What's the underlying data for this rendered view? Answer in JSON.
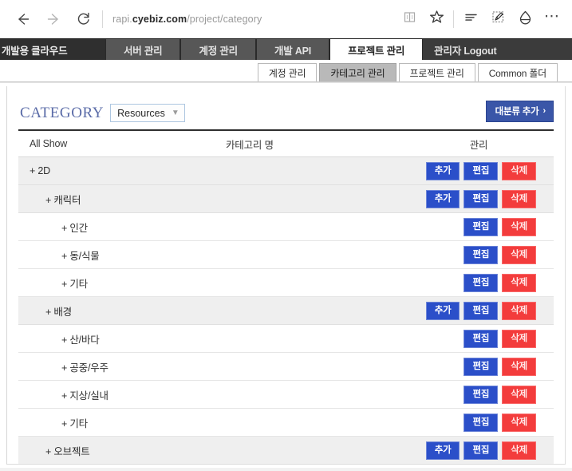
{
  "browser": {
    "back_icon": "arrow-left-icon",
    "forward_icon": "arrow-right-icon",
    "refresh_icon": "refresh-icon",
    "url_prefix": "rapi.",
    "url_host": "cyebiz.com",
    "url_path": "/project/category",
    "reading_view_icon": "book-icon",
    "favorites_icon": "star-icon",
    "hub_icon": "hub-lines-icon",
    "web_note_icon": "pen-note-icon",
    "share_icon": "share-icon",
    "more_label": "⋯"
  },
  "topnav": {
    "brand": "개발용 클라우드",
    "items": [
      {
        "label": "서버 관리",
        "active": false,
        "plain": false
      },
      {
        "label": "계정 관리",
        "active": false,
        "plain": false
      },
      {
        "label": "개발 API",
        "active": false,
        "plain": false
      },
      {
        "label": "프로젝트 관리",
        "active": true,
        "plain": false
      },
      {
        "label": "관리자 Logout",
        "active": false,
        "plain": true
      }
    ]
  },
  "subtabs": [
    {
      "label": "계정 관리",
      "active": false
    },
    {
      "label": "카테고리 관리",
      "active": true
    },
    {
      "label": "프로젝트 관리",
      "active": false
    },
    {
      "label": "Common 폴더",
      "active": false
    }
  ],
  "category_panel": {
    "title": "CATEGORY",
    "selected_resource": "Resources",
    "resource_options": [
      "Resources"
    ],
    "add_major_label": "대분류 추가",
    "add_major_chevron": "›",
    "columns": {
      "name": "All Show",
      "category_name": "카테고리 명",
      "manage": "관리"
    },
    "button_labels": {
      "add": "추가",
      "edit": "편집",
      "delete": "삭제"
    },
    "expander": "+",
    "rows": [
      {
        "label": "2D",
        "level": 0,
        "shaded": true,
        "actions": [
          "add",
          "edit",
          "delete"
        ]
      },
      {
        "label": "캐릭터",
        "level": 1,
        "shaded": true,
        "actions": [
          "add",
          "edit",
          "delete"
        ]
      },
      {
        "label": "인간",
        "level": 2,
        "shaded": false,
        "actions": [
          "edit",
          "delete"
        ]
      },
      {
        "label": "동/식물",
        "level": 2,
        "shaded": false,
        "actions": [
          "edit",
          "delete"
        ]
      },
      {
        "label": "기타",
        "level": 2,
        "shaded": false,
        "actions": [
          "edit",
          "delete"
        ]
      },
      {
        "label": "배경",
        "level": 1,
        "shaded": true,
        "actions": [
          "add",
          "edit",
          "delete"
        ]
      },
      {
        "label": "산/바다",
        "level": 2,
        "shaded": false,
        "actions": [
          "edit",
          "delete"
        ]
      },
      {
        "label": "공중/우주",
        "level": 2,
        "shaded": false,
        "actions": [
          "edit",
          "delete"
        ]
      },
      {
        "label": "지상/실내",
        "level": 2,
        "shaded": false,
        "actions": [
          "edit",
          "delete"
        ]
      },
      {
        "label": "기타",
        "level": 2,
        "shaded": false,
        "actions": [
          "edit",
          "delete"
        ]
      },
      {
        "label": "오브젝트",
        "level": 1,
        "shaded": true,
        "actions": [
          "add",
          "edit",
          "delete"
        ]
      }
    ]
  },
  "colors": {
    "accent_blue": "#2b4fc9",
    "danger_red": "#f33c3c",
    "header_blue": "#5b6ca8",
    "nav_dark": "#3b3b3b",
    "nav_item": "#575757",
    "add_major": "#3a56a8"
  }
}
